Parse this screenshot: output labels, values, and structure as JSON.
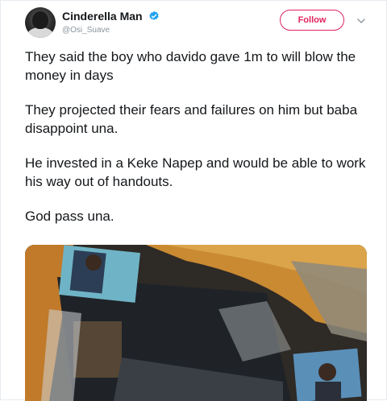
{
  "tweet": {
    "author": {
      "display_name": "Cinderella Man",
      "handle": "@Osi_Suave",
      "verified": true
    },
    "follow_label": "Follow",
    "paragraphs": [
      "They said the boy who davido gave 1m to will blow the money in days",
      "They projected their fears and failures on him but baba disappoint una.",
      "He invested in a Keke Napep and would be able to work his way out of  handouts.",
      "God pass una."
    ],
    "media": {
      "icon": "photo-icon"
    }
  },
  "colors": {
    "follow_accent": "#e0245e",
    "verified_blue": "#1da1f2",
    "handle_gray": "#8a959e"
  }
}
